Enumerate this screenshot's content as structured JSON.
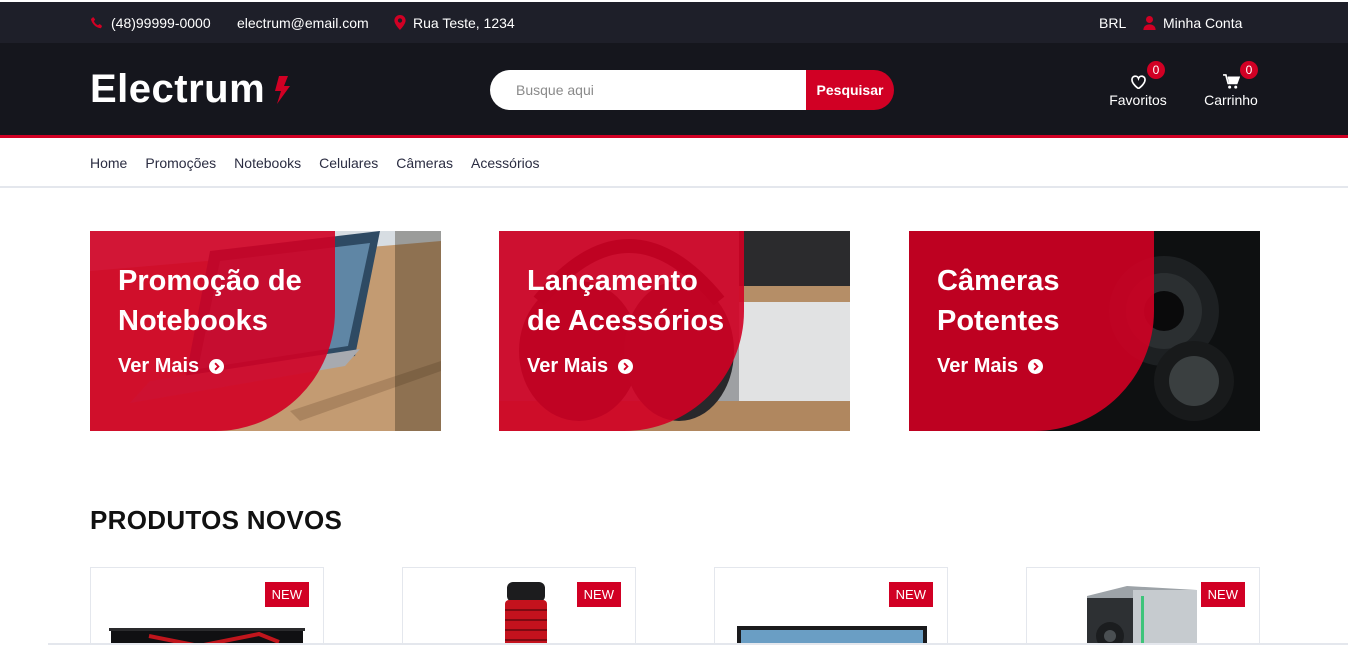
{
  "topbar": {
    "phone": "(48)99999-0000",
    "email": "electrum@email.com",
    "address": "Rua Teste, 1234",
    "currency": "BRL",
    "account": "Minha Conta"
  },
  "header": {
    "logo": "Electrum",
    "search_placeholder": "Busque aqui",
    "search_button": "Pesquisar",
    "wishlist_label": "Favoritos",
    "wishlist_count": "0",
    "cart_label": "Carrinho",
    "cart_count": "0"
  },
  "nav": {
    "items": [
      "Home",
      "Promoções",
      "Notebooks",
      "Celulares",
      "Câmeras",
      "Acessórios"
    ]
  },
  "collections": [
    {
      "title_line1": "Promoção de",
      "title_line2": "Notebooks",
      "cta": "Ver Mais"
    },
    {
      "title_line1": "Lançamento",
      "title_line2": "de Acessórios",
      "cta": "Ver Mais"
    },
    {
      "title_line1": "Câmeras",
      "title_line2": "Potentes",
      "cta": "Ver Mais"
    }
  ],
  "section": {
    "title": "PRODUTOS NOVOS"
  },
  "products": [
    {
      "badge": "NEW"
    },
    {
      "badge": "NEW"
    },
    {
      "badge": "NEW"
    },
    {
      "badge": "NEW"
    }
  ],
  "colors": {
    "accent": "#d10024",
    "topbar_bg": "#1e1f29",
    "header_bg": "#15161d"
  }
}
